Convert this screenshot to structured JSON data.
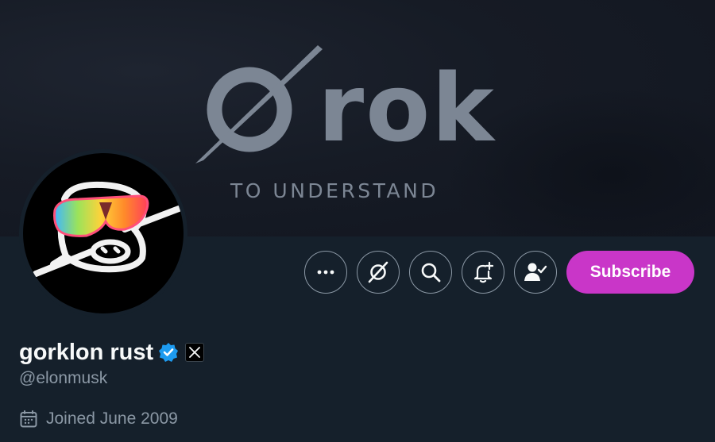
{
  "banner": {
    "logo_word": "rok",
    "tagline": "TO UNDERSTAND",
    "logo_icon": "grok-slash-circle-icon"
  },
  "avatar": {
    "icon": "scribble-face-with-sunglasses-icon"
  },
  "actions": {
    "more_icon": "more-dots-icon",
    "grok_icon": "grok-icon",
    "search_icon": "search-icon",
    "notify_icon": "bell-plus-icon",
    "following_icon": "person-check-icon",
    "subscribe_label": "Subscribe",
    "subscribe_color": "#c936c8"
  },
  "profile": {
    "display_name": "gorklon rust",
    "verified_icon": "verified-badge-icon",
    "affiliate_icon": "x-logo-icon",
    "handle": "@elonmusk",
    "joined_icon": "calendar-icon",
    "joined": "Joined June 2009"
  },
  "colors": {
    "background": "#15202b",
    "muted_text": "#8b98a5",
    "verified_blue": "#1d9bf0"
  }
}
